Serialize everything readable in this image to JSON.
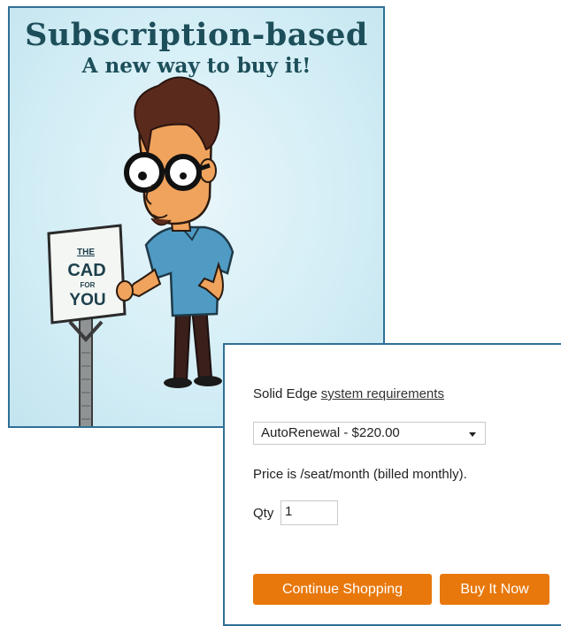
{
  "promo": {
    "title": "Subscription-based",
    "subtitle": "A new way to buy it!",
    "sign": {
      "line1": "THE",
      "line2": "CAD",
      "line3": "FOR",
      "line4": "YOU"
    }
  },
  "purchase": {
    "product_name": "Solid Edge",
    "requirements_link": "system requirements",
    "plan_selected": "AutoRenewal - $220.00",
    "price_note": "Price is /seat/month (billed monthly).",
    "qty_label": "Qty",
    "qty_value": "1",
    "continue_label": "Continue Shopping",
    "buy_label": "Buy It Now"
  },
  "colors": {
    "accent_button": "#e8780c",
    "border": "#2f6f96",
    "promo_text": "#1d4f5a"
  }
}
